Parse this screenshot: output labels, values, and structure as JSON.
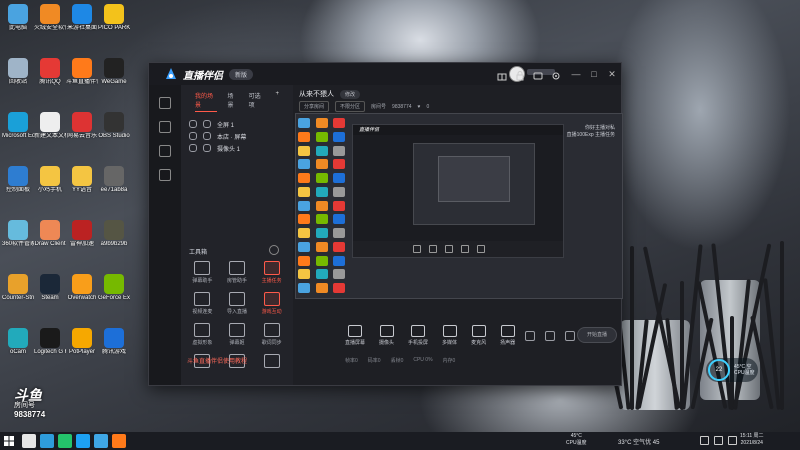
{
  "desktop": {
    "icons": [
      {
        "label": "此电脑",
        "color": "#4aa3e0"
      },
      {
        "label": "火绒安全软件",
        "color": "#f08a24"
      },
      {
        "label": "米游社桌面",
        "color": "#1e88e5"
      },
      {
        "label": "PICO PARK",
        "color": "#f3c21b"
      },
      {
        "label": "回收站",
        "color": "#9fb4c8"
      },
      {
        "label": "腾讯QQ",
        "color": "#e53935"
      },
      {
        "label": "斗鱼直播伴侣",
        "color": "#ff7a1a"
      },
      {
        "label": "WeGame",
        "color": "#222"
      },
      {
        "label": "Microsoft Edge",
        "color": "#1aa0d8"
      },
      {
        "label": "新建文本文档",
        "color": "#eeeeee"
      },
      {
        "label": "网易云音乐",
        "color": "#d33"
      },
      {
        "label": "OBS Studio",
        "color": "#333"
      },
      {
        "label": "控制面板",
        "color": "#2e7dd1"
      },
      {
        "label": "小鸡手机",
        "color": "#f4c542"
      },
      {
        "label": "YY语音",
        "color": "#f4c542"
      },
      {
        "label": "ee71ab8a",
        "color": "#666"
      },
      {
        "label": "360软件管家",
        "color": "#6bd"
      },
      {
        "label": "Draw Client",
        "color": "#e85"
      },
      {
        "label": "雷神加速",
        "color": "#b22"
      },
      {
        "label": "a9b9b29b",
        "color": "#554"
      },
      {
        "label": "Counter-Strike Global Off",
        "color": "#e8a12b"
      },
      {
        "label": "Steam",
        "color": "#1b2838"
      },
      {
        "label": "Overwatch",
        "color": "#f99e1a"
      },
      {
        "label": "GeForce Experience",
        "color": "#76b900"
      },
      {
        "label": "oCam",
        "color": "#2ab"
      },
      {
        "label": "Logitech G HUB",
        "color": "#1a1a1a"
      },
      {
        "label": "PotPlayer",
        "color": "#f6a800"
      },
      {
        "label": "腾讯游戏",
        "color": "#1d6fd8"
      }
    ]
  },
  "window": {
    "app_name": "直播伴侣",
    "version": "新版",
    "win_controls": [
      "—",
      "□",
      "✕"
    ],
    "scene_tabs": [
      "我的场景",
      "场景",
      "可选项"
    ],
    "add": "+",
    "sources": [
      "全屏 1",
      "本店 · 屏幕",
      "摄像头 1"
    ],
    "toolbox_title": "工具箱",
    "tools": [
      {
        "label": "弹幕助手",
        "hot": false
      },
      {
        "label": "房管助手",
        "hot": false
      },
      {
        "label": "主播任务",
        "hot": true
      },
      {
        "label": "视频连麦",
        "hot": false
      },
      {
        "label": "导入直播",
        "hot": false
      },
      {
        "label": "游戏互动",
        "hot": true
      },
      {
        "label": "虚拟形象",
        "hot": false
      },
      {
        "label": "弹幕姬",
        "hot": false
      },
      {
        "label": "歌词同步",
        "hot": false
      },
      {
        "label": "",
        "hot": false
      },
      {
        "label": "",
        "hot": false
      },
      {
        "label": "",
        "hot": false
      }
    ],
    "bottom_hint": "斗鱼直播伴侣使用教程",
    "room_title": "从来不猥人",
    "room_tag": "修改",
    "room_sub": [
      "分享房间",
      "不限分区"
    ],
    "room_id_label": "房间号",
    "room_id": "9838774",
    "room_likes": "0",
    "room_right": [
      "你好主播对私",
      "直播100Exp 主播任务"
    ],
    "nested_title": "直播伴侣",
    "controls": [
      "直播屏幕",
      "摄像头",
      "手机投屏",
      "多媒体",
      "麦克风",
      "扬声器"
    ],
    "start_label": "开始直播",
    "stats": [
      "帧率0",
      "码率0",
      "丢帧0",
      "CPU 0%",
      "内存0"
    ]
  },
  "badge": {
    "big": "斗鱼",
    "small": "房间号",
    "num": "9838774"
  },
  "cpu": {
    "percent": "22",
    "temp": "45°C 空",
    "label": "CPU温度"
  },
  "taskbar": {
    "cpu_temp": "45°C",
    "cpu_label": "CPU温度",
    "weather": "33°C 空气优 45",
    "time": "15:11 周二",
    "date": "2021/8/24"
  }
}
